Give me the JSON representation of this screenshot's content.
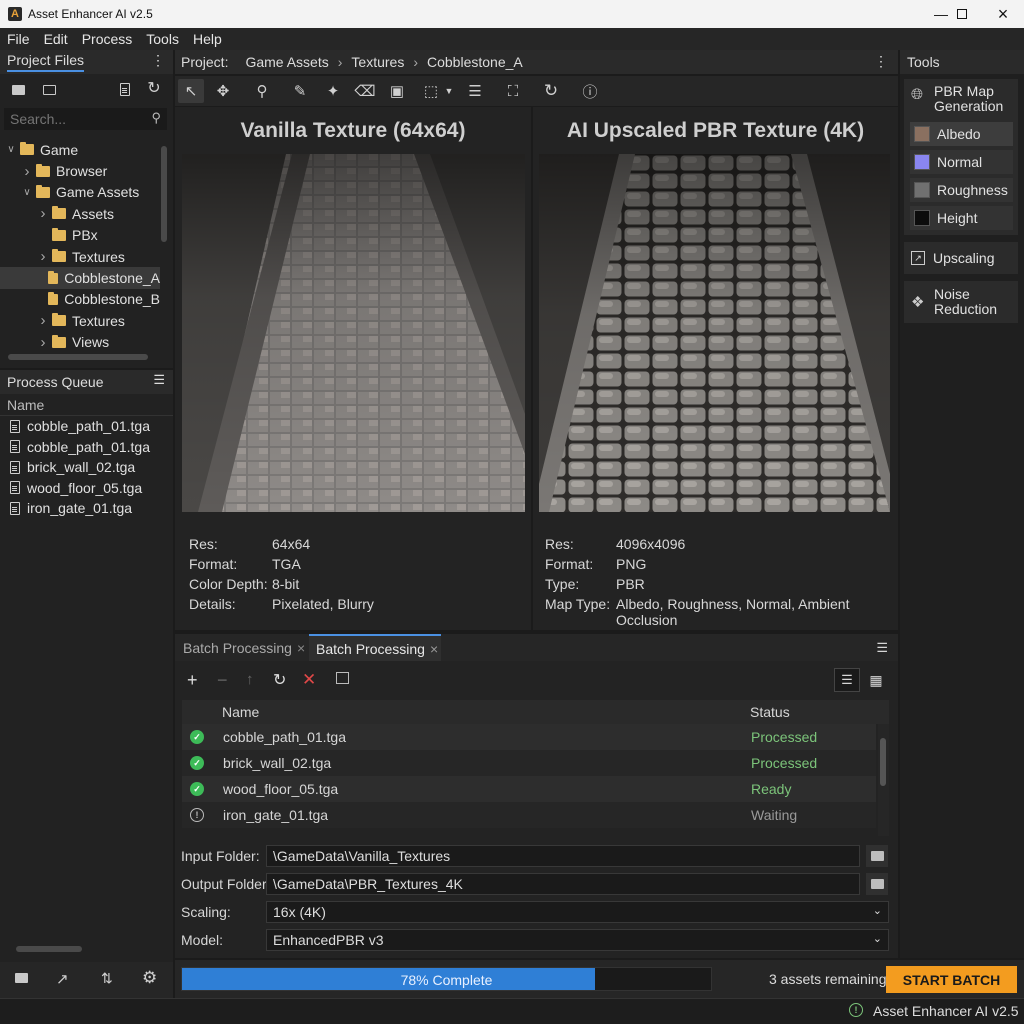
{
  "window": {
    "title": "Asset Enhancer AI v2.5"
  },
  "menu": [
    "File",
    "Edit",
    "Process",
    "Tools",
    "Help"
  ],
  "project_files": {
    "title": "Project Files",
    "search_placeholder": "Search...",
    "tree": [
      {
        "label": "Game",
        "depth": 0,
        "expanded": true
      },
      {
        "label": "Browser",
        "depth": 1,
        "expanded": false
      },
      {
        "label": "Game Assets",
        "depth": 1,
        "expanded": true
      },
      {
        "label": "Assets",
        "depth": 2,
        "expanded": false
      },
      {
        "label": "PBx",
        "depth": 2,
        "expanded": null
      },
      {
        "label": "Textures",
        "depth": 2,
        "expanded": false
      },
      {
        "label": "Cobblestone_A",
        "depth": 2,
        "expanded": null,
        "selected": true
      },
      {
        "label": "Cobblestone_B",
        "depth": 2,
        "expanded": null
      },
      {
        "label": "Textures",
        "depth": 2,
        "expanded": false
      },
      {
        "label": "Views",
        "depth": 2,
        "expanded": false
      }
    ]
  },
  "process_queue": {
    "title": "Process Queue",
    "column": "Name",
    "items": [
      "cobble_path_01.tga",
      "cobble_path_01.tga",
      "brick_wall_02.tga",
      "wood_floor_05.tga",
      "iron_gate_01.tga"
    ]
  },
  "breadcrumb": {
    "label": "Project:",
    "items": [
      "Game Assets",
      "Textures",
      "Cobblestone_A"
    ]
  },
  "left_view": {
    "title": "Vanilla Texture (64x64)",
    "info": [
      {
        "k": "Res:",
        "v": "64x64"
      },
      {
        "k": "Format:",
        "v": "TGA"
      },
      {
        "k": "Color Depth:",
        "v": "8-bit"
      },
      {
        "k": "Details:",
        "v": "Pixelated, Blurry"
      }
    ]
  },
  "right_view": {
    "title": "AI Upscaled PBR Texture (4K)",
    "info": [
      {
        "k": "Res:",
        "v": "4096x4096"
      },
      {
        "k": "Format:",
        "v": "PNG"
      },
      {
        "k": "Type:",
        "v": "PBR"
      },
      {
        "k": "Map Type:",
        "v": "Albedo, Roughness, Normal, Ambient Occlusion"
      }
    ]
  },
  "tools": {
    "title": "Tools",
    "pbr": "PBR Map Generation",
    "maps": [
      {
        "label": "Albedo",
        "color": "#8a7060"
      },
      {
        "label": "Normal",
        "color": "#8a86f0"
      },
      {
        "label": "Roughness",
        "color": "#707070"
      },
      {
        "label": "Height",
        "color": "#0c0c0c"
      }
    ],
    "upscaling": "Upscaling",
    "noise": "Noise Reduction"
  },
  "batch": {
    "tabs": [
      "Batch Processing",
      "Batch Processing"
    ],
    "columns": {
      "name": "Name",
      "status": "Status"
    },
    "rows": [
      {
        "name": "cobble_path_01.tga",
        "status": "Processed",
        "state": "ok"
      },
      {
        "name": "brick_wall_02.tga",
        "status": "Processed",
        "state": "ok"
      },
      {
        "name": "wood_floor_05.tga",
        "status": "Ready",
        "state": "ok"
      },
      {
        "name": "iron_gate_01.tga",
        "status": "Waiting",
        "state": "wait"
      }
    ],
    "input_label": "Input Folder:",
    "input_value": "\\GameData\\Vanilla_Textures",
    "output_label": "Output Folder:",
    "output_value": "\\GameData\\PBR_Textures_4K",
    "scaling_label": "Scaling:",
    "scaling_value": "16x (4K)",
    "model_label": "Model:",
    "model_value": "EnhancedPBR v3"
  },
  "progress": {
    "percent": 78,
    "label": "78% Complete",
    "remaining": "3 assets remaining",
    "start": "START BATCH"
  },
  "status": {
    "text": "Asset Enhancer AI v2.5"
  },
  "colors": {
    "accent": "#f39c1f",
    "progress": "#2f7fd6",
    "ok": "#3dbb58",
    "status_ok": "#7cc47a"
  }
}
